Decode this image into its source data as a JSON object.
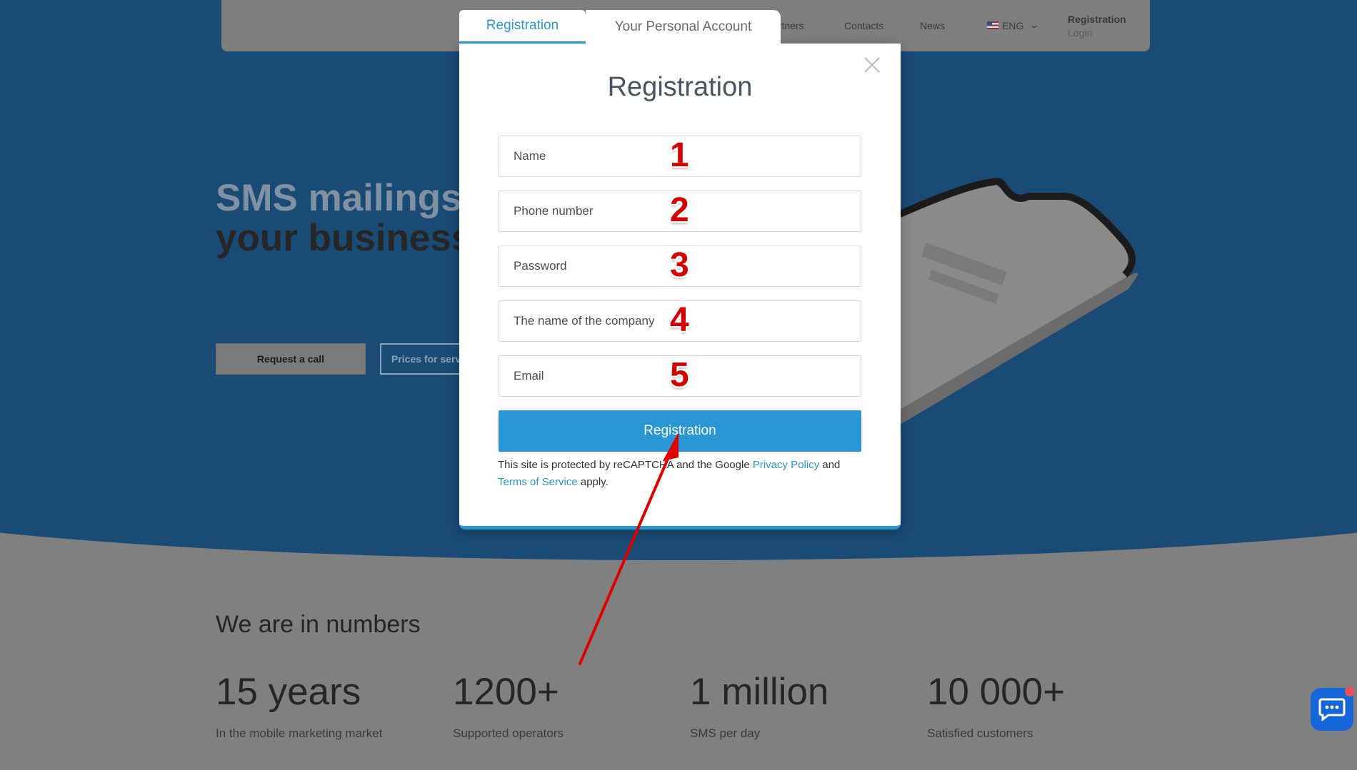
{
  "header": {
    "nav": [
      "artners",
      "Contacts",
      "News"
    ],
    "language": "ENG",
    "registration": "Registration",
    "login": "Login"
  },
  "hero": {
    "title_line1": "SMS mailings",
    "title_line2": "your business",
    "btn_call": "Request a call",
    "btn_prices": "Prices for servi"
  },
  "numbers": {
    "title": "We are in numbers",
    "stats": [
      {
        "value": "15 years",
        "label": "In the mobile marketing market"
      },
      {
        "value": "1200+",
        "label": "Supported operators"
      },
      {
        "value": "1 million",
        "label": "SMS per day"
      },
      {
        "value": "10 000+",
        "label": "Satisfied customers"
      }
    ]
  },
  "modal": {
    "tabs": [
      "Registration",
      "Your Personal Account"
    ],
    "title": "Registration",
    "fields": [
      {
        "placeholder": "Name",
        "marker": "1"
      },
      {
        "placeholder": "Phone number",
        "marker": "2"
      },
      {
        "placeholder": "Password",
        "marker": "3"
      },
      {
        "placeholder": "The name of the company",
        "marker": "4"
      },
      {
        "placeholder": "Email",
        "marker": "5"
      }
    ],
    "submit": "Registration",
    "legal_pre": "This site is protected by reCAPTCHA and the Google",
    "privacy": "Privacy Policy",
    "legal_and": "and",
    "terms": "Terms of Service",
    "legal_post": "apply."
  },
  "colors": {
    "accent": "#2996d5",
    "marker": "#d40000",
    "hero_bg": "#1a4b75",
    "chat": "#1566d8"
  },
  "icons": [
    "close-icon",
    "flag-us-icon",
    "chevron-down-icon",
    "chat-icon",
    "annotation-arrow"
  ]
}
